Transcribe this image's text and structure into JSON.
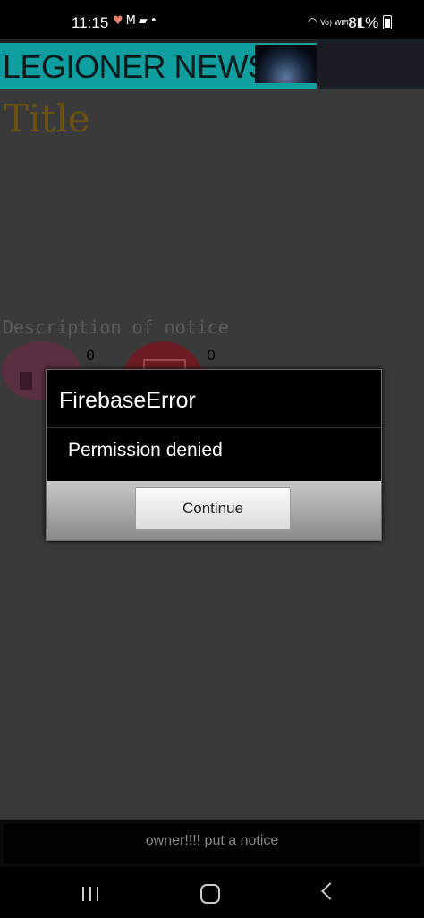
{
  "status_bar": {
    "time": "11:15",
    "network": "Vo) WiFi2",
    "battery": "81%"
  },
  "header": {
    "app_title": "LEGIONER NEWS",
    "brand_color": "#0f9ea0"
  },
  "notice": {
    "title": "Title",
    "description": "Description of notice",
    "likes": "0",
    "dislikes": "0"
  },
  "dialog": {
    "title": "FirebaseError",
    "message": "Permission denied",
    "button_label": "Continue"
  },
  "footer": {
    "text": "owner!!!! put a notice"
  },
  "icons": [
    "heart-icon",
    "gmail-icon",
    "message-icon",
    "wifi-icon",
    "signal-icon",
    "battery-icon",
    "like-icon",
    "dislike-icon",
    "recents-icon",
    "home-icon",
    "back-icon"
  ]
}
